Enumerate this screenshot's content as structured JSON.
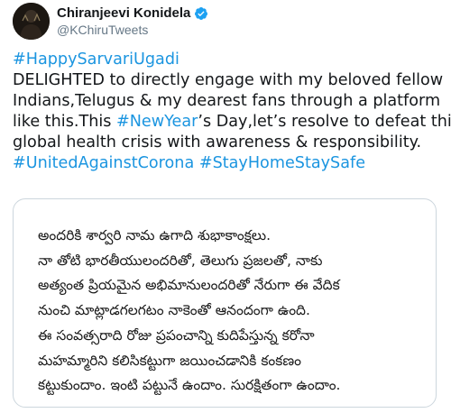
{
  "author": {
    "display_name": "Chiranjeevi Konidela",
    "handle": "@KChiruTweets",
    "verified": true,
    "verified_color": "#1da1f2",
    "avatar": "profile-photo"
  },
  "tweet": {
    "lines": [
      [
        {
          "text": "#HappySarvariUgadi",
          "tag": true
        }
      ],
      [
        {
          "text": "DELIGHTED to directly engage with my beloved fellow",
          "tag": false
        }
      ],
      [
        {
          "text": "Indians,Telugus & my dearest fans through a platform",
          "tag": false
        }
      ],
      [
        {
          "text": "like this.This ",
          "tag": false
        },
        {
          "text": "#NewYear",
          "tag": true
        },
        {
          "text": "’s Day,let’s resolve to defeat this",
          "tag": false
        }
      ],
      [
        {
          "text": "global health crisis with awareness & responsibility.",
          "tag": false
        }
      ],
      [
        {
          "text": "#UnitedAgainstCorona",
          "tag": true
        },
        {
          "text": " ",
          "tag": false
        },
        {
          "text": "#StayHomeStaySafe",
          "tag": true
        }
      ]
    ],
    "link_color": "#1b95e0"
  },
  "media": {
    "lines": [
      "అందరికి శార్వరి నామ ఉగాది శుభాకాంక్షలు.",
      "నా తోటి భారతీయులందరితో, తెలుగు ప్రజలతో, నాకు",
      "అత్యంత ప్రియమైన అభిమానులందరితో నేరుగా ఈ వేదిక",
      "నుంచి మాట్లాడగలగటం నాకెంతో ఆనందంగా ఉంది.",
      "ఈ సంవత్సరాది రోజు ప్రపంచాన్ని కుదిపేస్తున్న కరోనా",
      "మహమ్మారిని కలిసికట్టుగా జయించడానికి కంకణం",
      "కట్టుకుందాం. ఇంటి పట్టునే ఉందాం. సురక్షితంగా ఉందాం."
    ]
  }
}
